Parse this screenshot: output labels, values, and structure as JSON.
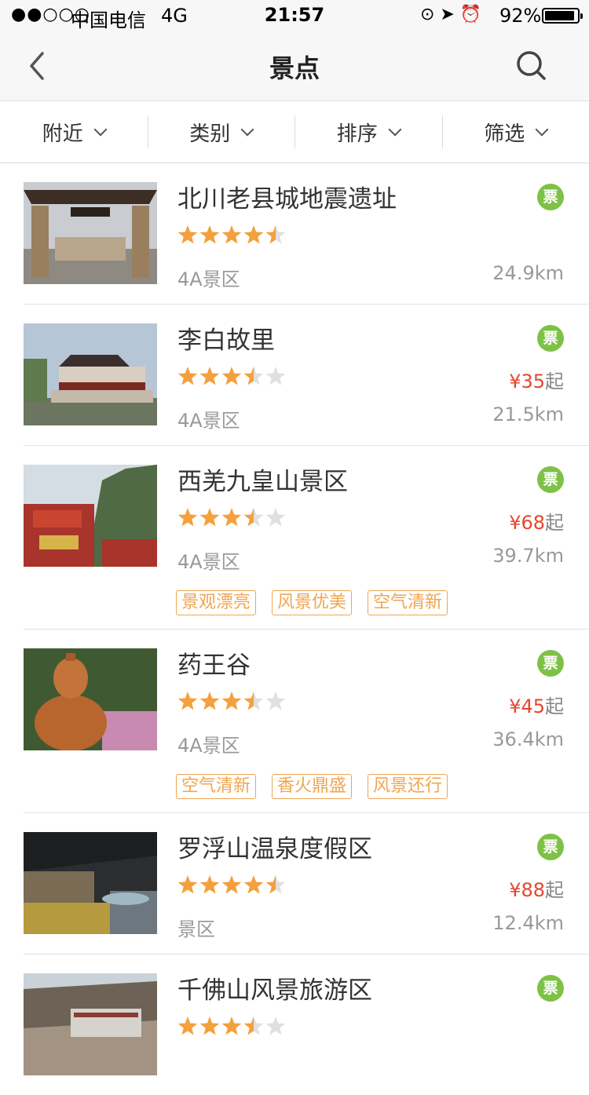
{
  "status_bar": {
    "signal": "●●○○○",
    "carrier": "中国电信",
    "network": "4G",
    "time": "21:57",
    "icons": "⊙ ➤ ⏰",
    "battery": "92%",
    "battery_level": 0.92
  },
  "nav": {
    "title": "景点",
    "back_icon": "chevron-left-icon",
    "search_icon": "search-icon"
  },
  "filters": [
    {
      "label": "附近"
    },
    {
      "label": "类别"
    },
    {
      "label": "排序"
    },
    {
      "label": "筛选"
    }
  ],
  "colors": {
    "accent_price": "#e6462e",
    "ticket_badge": "#7dc246",
    "star": "#f4a03c",
    "tag": "#f0a550"
  },
  "spots": [
    {
      "name": "北川老县城地震遗址",
      "rating": 4.5,
      "level": "4A景区",
      "ticket": "票",
      "price": "",
      "price_suffix": "",
      "distance": "24.9km",
      "tags": []
    },
    {
      "name": "李白故里",
      "rating": 3.5,
      "level": "4A景区",
      "ticket": "票",
      "price": "¥35",
      "price_suffix": "起",
      "distance": "21.5km",
      "tags": []
    },
    {
      "name": "西羌九皇山景区",
      "rating": 3.5,
      "level": "4A景区",
      "ticket": "票",
      "price": "¥68",
      "price_suffix": "起",
      "distance": "39.7km",
      "tags": [
        "景观漂亮",
        "风景优美",
        "空气清新"
      ]
    },
    {
      "name": "药王谷",
      "rating": 3.5,
      "level": "4A景区",
      "ticket": "票",
      "price": "¥45",
      "price_suffix": "起",
      "distance": "36.4km",
      "tags": [
        "空气清新",
        "香火鼎盛",
        "风景还行"
      ]
    },
    {
      "name": "罗浮山温泉度假区",
      "rating": 4.5,
      "level": "景区",
      "ticket": "票",
      "price": "¥88",
      "price_suffix": "起",
      "distance": "12.4km",
      "tags": []
    },
    {
      "name": "千佛山风景旅游区",
      "rating": 3.5,
      "level": "",
      "ticket": "票",
      "price": "",
      "price_suffix": "",
      "distance": "",
      "tags": []
    }
  ]
}
